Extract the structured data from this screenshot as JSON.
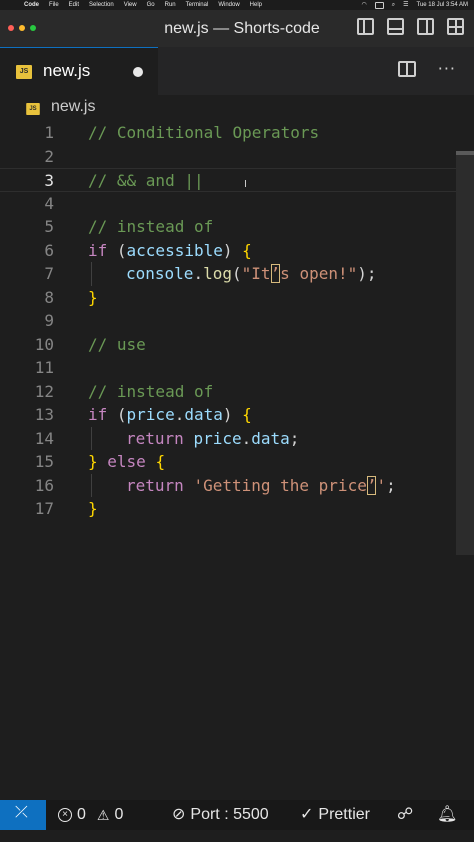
{
  "menubar": {
    "app": "Code",
    "menus": [
      "File",
      "Edit",
      "Selection",
      "View",
      "Go",
      "Run",
      "Terminal",
      "Window",
      "Help"
    ],
    "datetime": "Tue 18 Jul  3:54 AM"
  },
  "window": {
    "title": "new.js — Shorts-code",
    "traffic_colors": [
      "#ff5f57",
      "#febc2e",
      "#28c840"
    ]
  },
  "tab": {
    "badge": "JS",
    "label": "new.js"
  },
  "breadcrumb": {
    "badge": "JS",
    "label": "new.js"
  },
  "editor": {
    "current_line": 3,
    "lines": [
      {
        "n": "1"
      },
      {
        "n": "2"
      },
      {
        "n": "3"
      },
      {
        "n": "4"
      },
      {
        "n": "5"
      },
      {
        "n": "6"
      },
      {
        "n": "7"
      },
      {
        "n": "8"
      },
      {
        "n": "9"
      },
      {
        "n": "10"
      },
      {
        "n": "11"
      },
      {
        "n": "12"
      },
      {
        "n": "13"
      },
      {
        "n": "14"
      },
      {
        "n": "15"
      },
      {
        "n": "16"
      },
      {
        "n": "17"
      }
    ],
    "code": {
      "l1": "// Conditional Operators",
      "l3": "// && and ||",
      "l5": "// instead of",
      "l6_kw": "if",
      "l6_open": " (",
      "l6_var": "accessible",
      "l6_close": ") ",
      "l6_brace": "{",
      "l7_obj": "console",
      "l7_dot": ".",
      "l7_fn": "log",
      "l7_paren": "(",
      "l7_str_a": "\"It",
      "l7_str_b": "’",
      "l7_str_c": "s open!\"",
      "l7_end": ");",
      "l8_brace": "}",
      "l10": "// use",
      "l12": "// instead of",
      "l13_kw": "if",
      "l13_open": " (",
      "l13_var1": "price",
      "l13_dot": ".",
      "l13_var2": "data",
      "l13_close": ") ",
      "l13_brace": "{",
      "l14_kw": "return",
      "l14_sp": " ",
      "l14_var1": "price",
      "l14_dot": ".",
      "l14_var2": "data",
      "l14_end": ";",
      "l15_brace1": "}",
      "l15_kw": " else ",
      "l15_brace2": "{",
      "l16_kw": "return",
      "l16_sp": " ",
      "l16_str_a": "'Getting the price",
      "l16_str_b": "’",
      "l16_str_c": "'",
      "l16_end": ";",
      "l17_brace": "}"
    }
  },
  "statusbar": {
    "errors": "0",
    "warnings": "0",
    "port": "Port : 5500",
    "prettier": "Prettier"
  }
}
